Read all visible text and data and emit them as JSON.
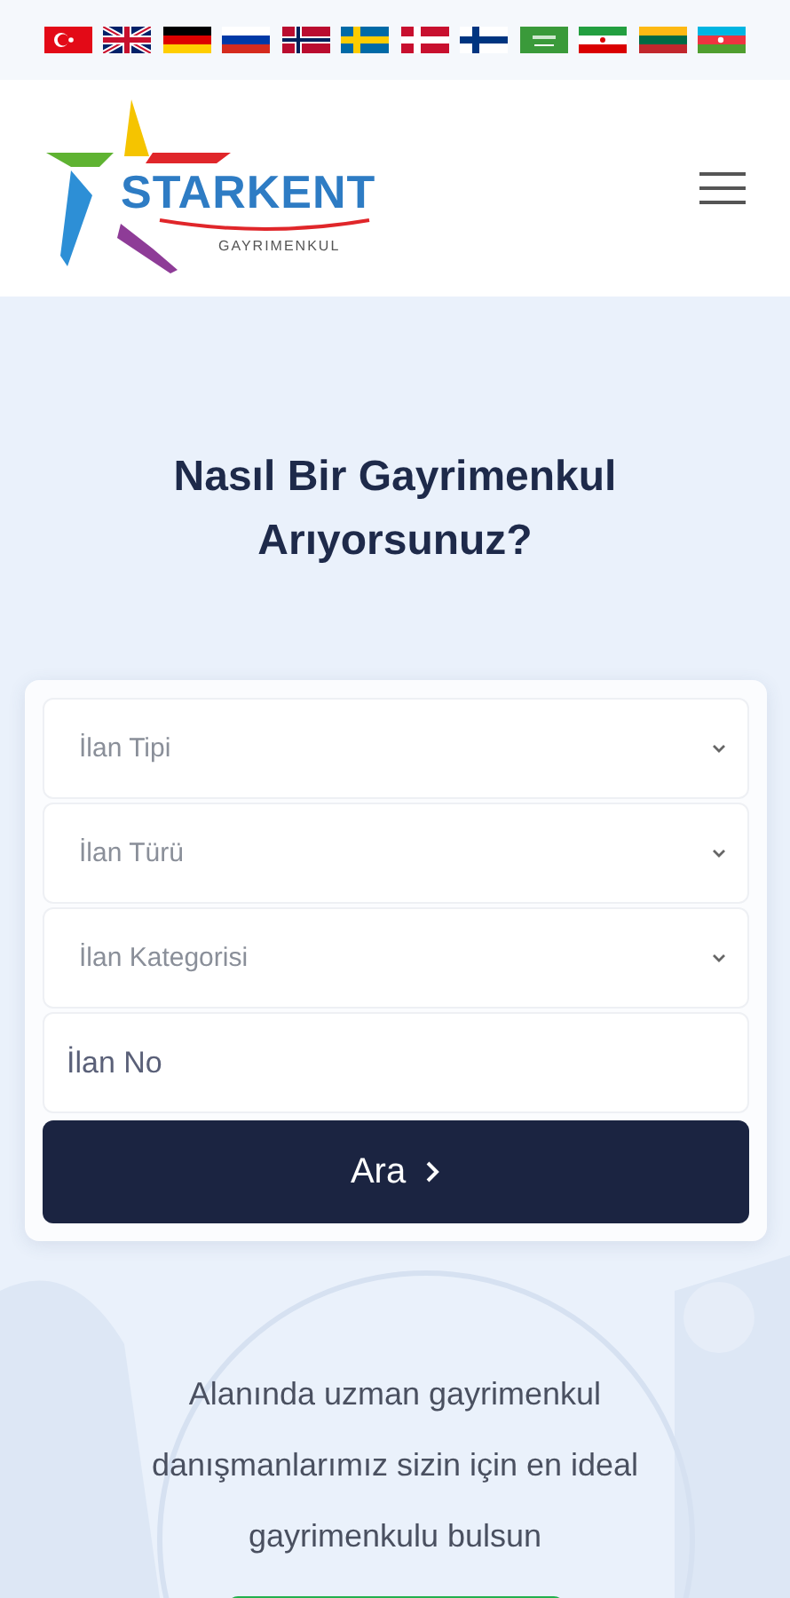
{
  "language_flags": [
    {
      "kind": "turkey"
    },
    {
      "kind": "uk"
    },
    {
      "kind": "germany"
    },
    {
      "kind": "russia"
    },
    {
      "kind": "norway"
    },
    {
      "kind": "sweden"
    },
    {
      "kind": "denmark"
    },
    {
      "kind": "finland"
    },
    {
      "kind": "saudi"
    },
    {
      "kind": "iran"
    },
    {
      "kind": "lithuania"
    },
    {
      "kind": "azerbaijan"
    }
  ],
  "header": {
    "logo": {
      "name": "STARKENT",
      "tagline": "GAYRIMENKUL"
    }
  },
  "hero": {
    "title": "Nasıl Bir Gayrimenkul Arıyorsunuz?",
    "search_form": {
      "fields": [
        {
          "kind": "select",
          "placeholder": "İlan Tipi"
        },
        {
          "kind": "select",
          "placeholder": "İlan Türü"
        },
        {
          "kind": "select",
          "placeholder": "İlan Kategorisi"
        },
        {
          "kind": "input",
          "placeholder": "İlan No"
        }
      ],
      "submit": {
        "label": "Ara"
      }
    }
  },
  "intro": {
    "text": "Alanında uzman gayrimenkul danışmanlarımız sizin için en ideal gayrimenkulu bulsun"
  }
}
